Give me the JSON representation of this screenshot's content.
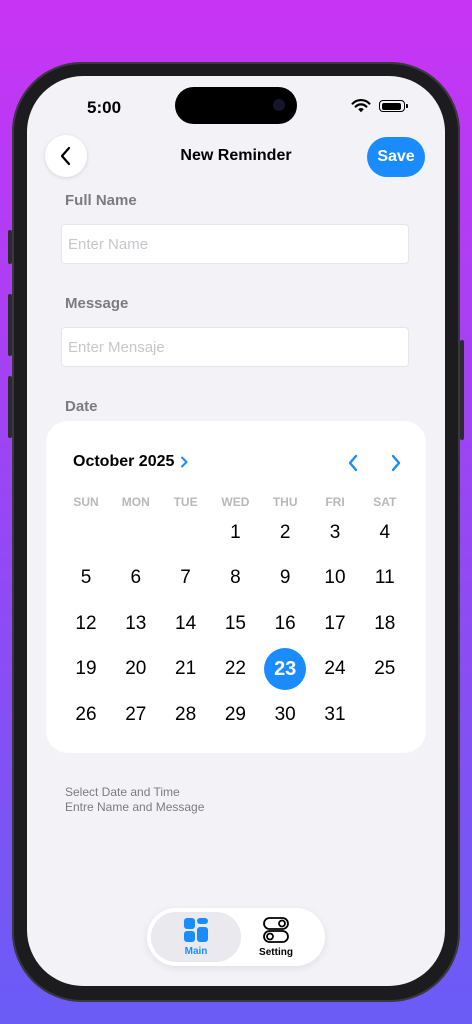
{
  "status_bar": {
    "time": "5:00"
  },
  "nav": {
    "back_icon": "chevron-left-icon",
    "title": "New Reminder",
    "save_label": "Save"
  },
  "form": {
    "name_label": "Full Name",
    "name_placeholder": "Enter Name",
    "message_label": "Message",
    "message_placeholder": "Enter Mensaje",
    "date_label": "Date"
  },
  "calendar": {
    "month_label": "October 2025",
    "weekdays": [
      "SUN",
      "MON",
      "TUE",
      "WED",
      "THU",
      "FRI",
      "SAT"
    ],
    "days": [
      1,
      2,
      3,
      4,
      5,
      6,
      7,
      8,
      9,
      10,
      11,
      12,
      13,
      14,
      15,
      16,
      17,
      18,
      19,
      20,
      21,
      22,
      23,
      24,
      25,
      26,
      27,
      28,
      29,
      30,
      31
    ],
    "first_weekday_index": 3,
    "selected_day": 23
  },
  "hints": {
    "line1": "Select Date and Time",
    "line2": "Entre Name and Message"
  },
  "tabbar": {
    "tabs": [
      {
        "label": "Main",
        "icon": "grid-icon",
        "active": true
      },
      {
        "label": "Setting",
        "icon": "toggles-icon",
        "active": false
      }
    ]
  },
  "colors": {
    "accent": "#1a8cff",
    "background": "#f2f2f7"
  }
}
